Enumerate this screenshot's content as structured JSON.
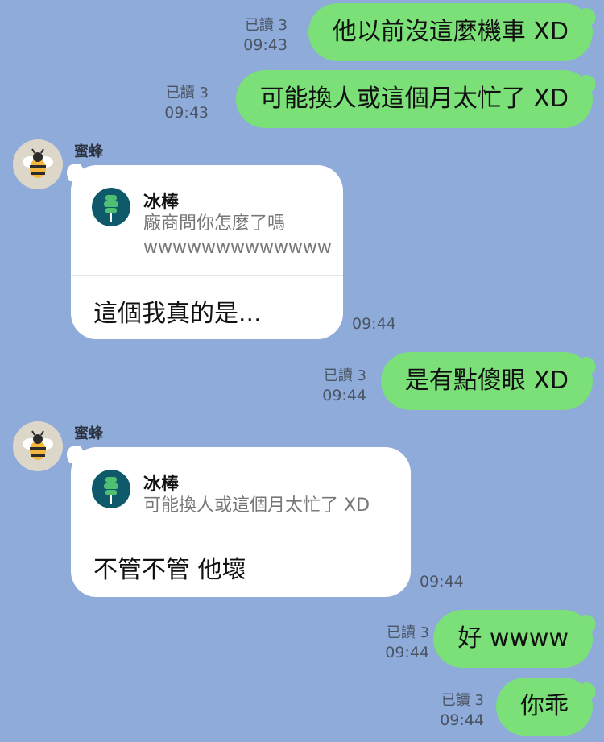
{
  "read_label": "已讀 3",
  "icons": {
    "avatar": "bee-icon",
    "quote_avatar": "popsicle-icon"
  },
  "colors": {
    "background": "#8eabd9",
    "outgoing_bubble": "#7ae077",
    "incoming_bubble": "#ffffff",
    "quote_avatar": "#0f5a6a",
    "bee_avatar_bg": "#ddd7c9"
  },
  "messages": [
    {
      "text": "他以前沒這麼機車 XD",
      "time": "09:43",
      "read": "已讀 3"
    },
    {
      "text": "可能換人或這個月太忙了 XD",
      "time": "09:43",
      "read": "已讀 3"
    },
    {
      "sender": "蜜蜂",
      "quote_name": "冰棒",
      "quote_lines": [
        "廠商問你怎麼了嗎",
        "wwwwwwwwwwwww"
      ],
      "text": "這個我真的是...",
      "time": "09:44"
    },
    {
      "text": "是有點傻眼 XD",
      "time": "09:44",
      "read": "已讀 3"
    },
    {
      "sender": "蜜蜂",
      "quote_name": "冰棒",
      "quote_lines": [
        "可能換人或這個月太忙了 XD"
      ],
      "text": "不管不管  他壞",
      "time": "09:44"
    },
    {
      "text": "好 wwww",
      "time": "09:44",
      "read": "已讀 3"
    },
    {
      "text": "你乖",
      "time": "09:44",
      "read": "已讀 3"
    }
  ]
}
